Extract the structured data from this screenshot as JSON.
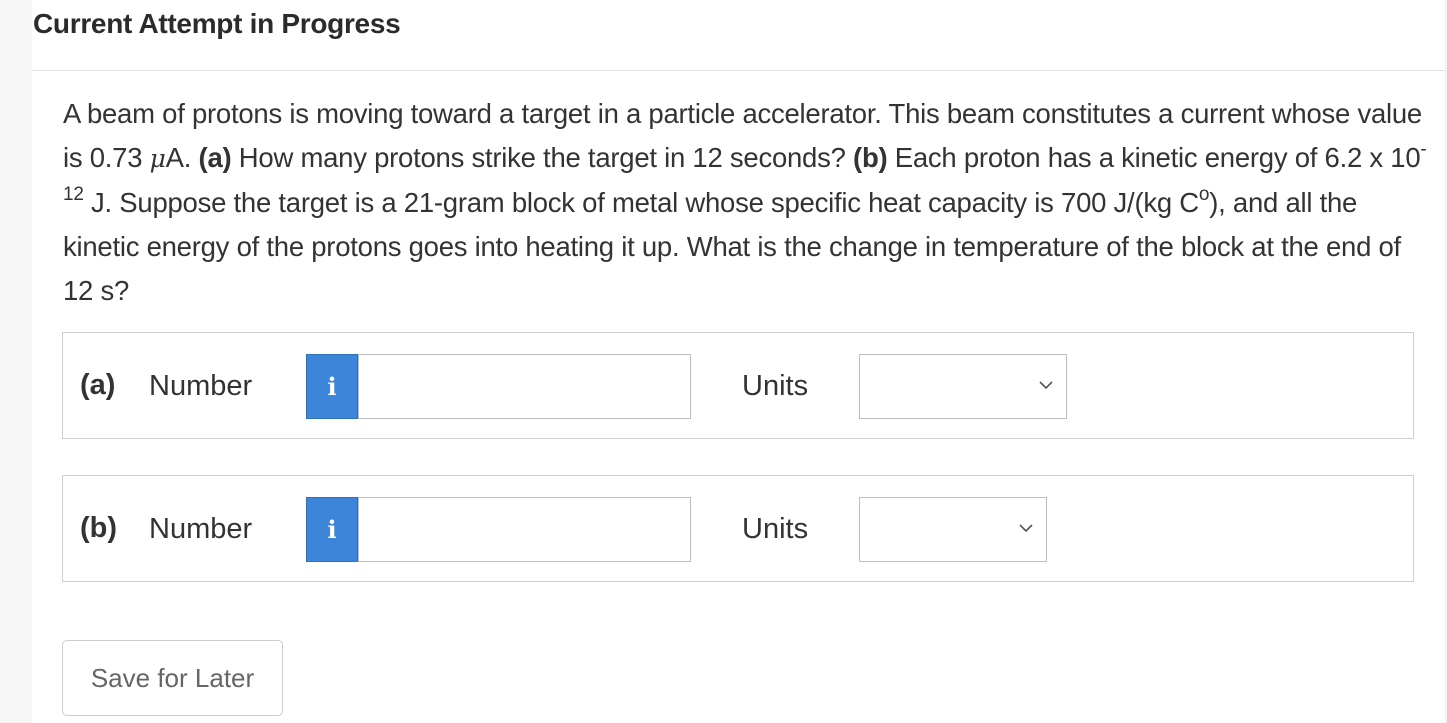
{
  "header": {
    "title": "Current Attempt in Progress"
  },
  "question": {
    "p1": "A beam of protons is moving toward a target in a particle accelerator. This beam constitutes a current whose value is 0.73 ",
    "mu": "μ",
    "p2": "A. ",
    "a_tag": "(a)",
    "p3": " How many protons strike the target in 12 seconds? ",
    "b_tag": "(b)",
    "p4": " Each proton has a kinetic energy of 6.2 x 10",
    "exp": "-12",
    "p5": " J. Suppose the target is a 21-gram block of metal whose specific heat capacity is 700 J/(kg C",
    "deg": "o",
    "p6": "), and all the kinetic energy of the protons goes into heating it up. What is the change in temperature of the block at the end of 12 s?"
  },
  "parts": [
    {
      "label": "(a)",
      "number_label": "Number",
      "info_icon": "i",
      "input_value": "",
      "units_label": "Units",
      "units_selected": ""
    },
    {
      "label": "(b)",
      "number_label": "Number",
      "info_icon": "i",
      "input_value": "",
      "units_label": "Units",
      "units_selected": ""
    }
  ],
  "actions": {
    "save_label": "Save for Later"
  },
  "colors": {
    "info_button": "#3d85d8",
    "text": "#333333",
    "border": "#cfcfcf"
  }
}
